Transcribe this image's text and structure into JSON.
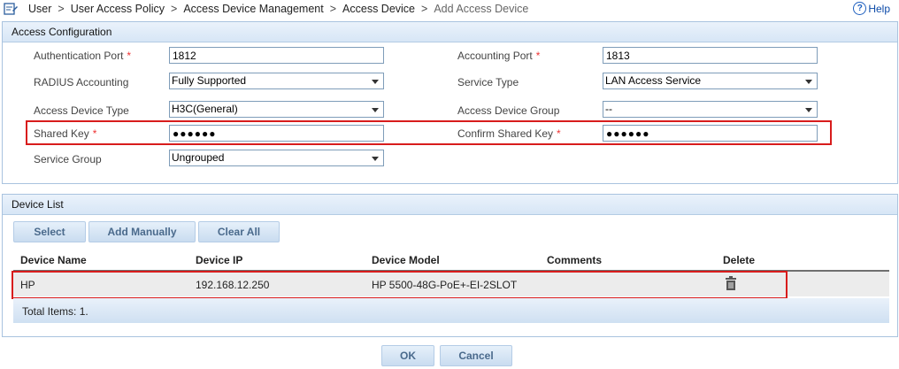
{
  "breadcrumb": {
    "items": [
      "User",
      "User Access Policy",
      "Access Device Management",
      "Access Device",
      "Add Access Device"
    ],
    "separator": ">"
  },
  "help_label": "Help",
  "access_config": {
    "title": "Access Configuration",
    "required_mark": "*",
    "auth_port": {
      "label": "Authentication Port",
      "value": "1812"
    },
    "acct_port": {
      "label": "Accounting Port",
      "value": "1813"
    },
    "radius_accounting": {
      "label": "RADIUS Accounting",
      "value": "Fully Supported"
    },
    "service_type": {
      "label": "Service Type",
      "value": "LAN Access Service"
    },
    "device_type": {
      "label": "Access Device Type",
      "value": "H3C(General)"
    },
    "device_group": {
      "label": "Access Device Group",
      "value": "--"
    },
    "shared_key": {
      "label": "Shared Key",
      "value": "●●●●●●"
    },
    "confirm_key": {
      "label": "Confirm Shared Key",
      "value": "●●●●●●"
    },
    "service_group": {
      "label": "Service Group",
      "value": "Ungrouped"
    }
  },
  "device_list": {
    "title": "Device List",
    "buttons": {
      "select": "Select",
      "add_manually": "Add Manually",
      "clear_all": "Clear All"
    },
    "columns": [
      "Device Name",
      "Device IP",
      "Device Model",
      "Comments",
      "Delete"
    ],
    "rows": [
      {
        "name": "HP",
        "ip": "192.168.12.250",
        "model": "HP 5500-48G-PoE+-EI-2SLOT",
        "comments": ""
      }
    ],
    "total": "Total Items: 1."
  },
  "footer": {
    "ok": "OK",
    "cancel": "Cancel"
  },
  "colors": {
    "highlight_red": "#d81c1c",
    "panel_border": "#a9c3df",
    "link_blue": "#0b4aa8"
  }
}
